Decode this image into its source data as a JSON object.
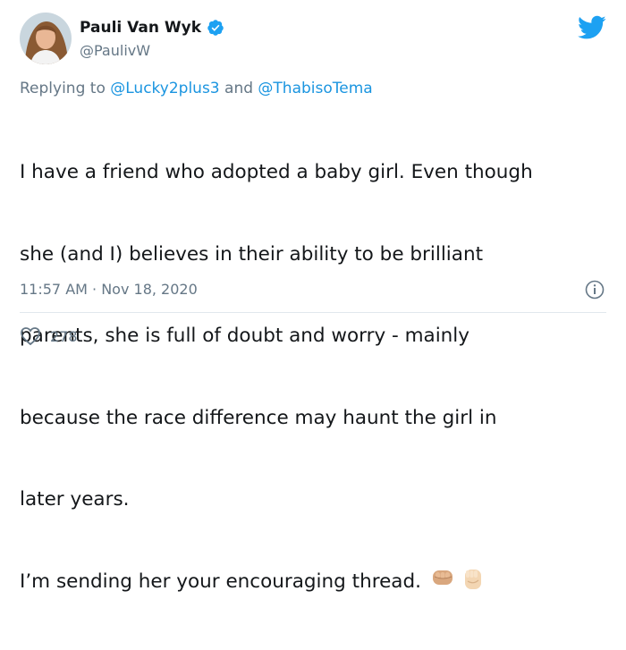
{
  "author": {
    "name": "Pauli Van Wyk",
    "handle": "@PaulivW",
    "verified_icon": "verified-badge-icon",
    "avatar_icon": "avatar"
  },
  "reply": {
    "prefix": "Replying to ",
    "mention1": "@Lucky2plus3",
    "joiner": " and ",
    "mention2": "@ThabisoTema"
  },
  "tweet": {
    "lines": [
      "I have a friend who adopted a baby girl. Even though",
      "she (and I) believes in their ability to be brilliant",
      "parents, she is full of doubt and worry - mainly",
      "because the race difference may haunt the girl in",
      "later years.",
      "I’m sending her your encouraging thread."
    ],
    "emoji": [
      "oncoming-fist-medium-skin-tone",
      "raised-fist-light-skin-tone"
    ]
  },
  "meta": {
    "timestamp": "11:57 AM · Nov 18, 2020"
  },
  "stats": {
    "likes": "278"
  },
  "colors": {
    "brand": "#1da1f2",
    "link": "#1b95e0",
    "muted": "#657786",
    "text": "#14171a",
    "divider": "#e1e8ed"
  }
}
